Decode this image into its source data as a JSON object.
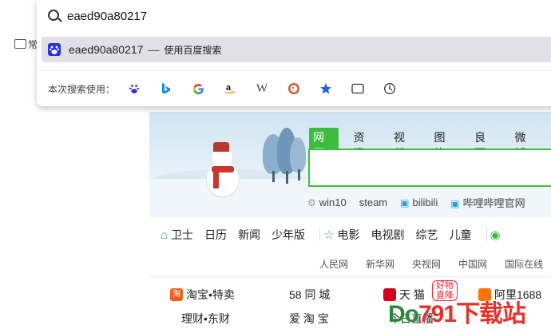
{
  "omnibox": {
    "query": "eaed90a80217",
    "suggestion_text": "eaed90a80217",
    "suggestion_separator": "—",
    "suggestion_action": "使用百度搜索",
    "engines_label": "本次搜索使用：",
    "engines": [
      "baidu-icon",
      "bing-icon",
      "google-icon",
      "amazon-icon",
      "wikipedia-icon",
      "duckduckgo-icon",
      "bookmarks-star-icon",
      "tabs-icon",
      "history-clock-icon"
    ],
    "wiki_glyph": "W"
  },
  "bookmarks": {
    "folder_label": "常"
  },
  "baidu_page": {
    "tabs": [
      "网页",
      "资讯",
      "视频",
      "图片",
      "良医",
      "微博"
    ],
    "hotwords": [
      "win10",
      "steam",
      "bilibili",
      "哔哩哔哩官网"
    ],
    "nav": [
      "卫士",
      "日历",
      "新闻",
      "少年版",
      "电影",
      "电视剧",
      "综艺",
      "儿童"
    ],
    "subnav": [
      "人民网",
      "新华网",
      "央视网",
      "中国网",
      "国际在线"
    ],
    "sites": {
      "taobao": "淘宝•特卖",
      "taobao_icon": "淘",
      "city58": "58 同 城",
      "tmall": "天 猫",
      "tmall_badge": "好物直降",
      "ali": "阿里1688",
      "licai": "理财•东财",
      "aitaobao": "爱 淘 宝",
      "jinri": "今日直播"
    },
    "watermark": {
      "part1": "Do",
      "part2": "791",
      "part3": "下载站"
    }
  },
  "colors": {
    "accent_green": "#3dbd3d",
    "baidu_blue": "#2932e1",
    "suggestion_bg": "#e1e0e6"
  }
}
